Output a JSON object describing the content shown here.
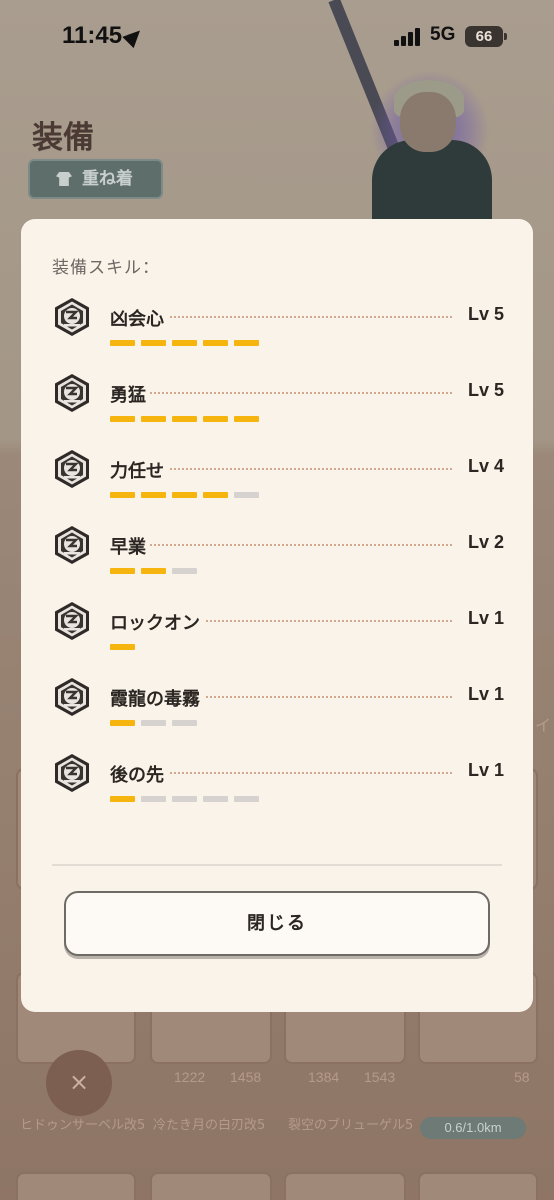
{
  "status_bar": {
    "time": "11:45",
    "network": "5G",
    "battery": "66"
  },
  "background": {
    "title": "装備",
    "stack_button": "重ね着",
    "cards": [
      {
        "nums": [
          "",
          ""
        ],
        "label": "ヒドゥンサーベル改5"
      },
      {
        "nums": [
          "1222",
          "1458"
        ],
        "label": "冷たき月の白刃改5"
      },
      {
        "nums": [
          "1384",
          "1543"
        ],
        "label": "裂空のブリューゲル5"
      },
      {
        "nums": [
          "",
          "58"
        ],
        "label": ""
      }
    ],
    "distance_pill": "0.6/1.0km",
    "close_x": "×"
  },
  "modal": {
    "title": "装備スキル：",
    "skills": [
      {
        "name": "凶会心",
        "level": "Lv 5",
        "filled": 5,
        "max": 5
      },
      {
        "name": "勇猛",
        "level": "Lv 5",
        "filled": 5,
        "max": 5
      },
      {
        "name": "力任せ",
        "level": "Lv 4",
        "filled": 4,
        "max": 5
      },
      {
        "name": "早業",
        "level": "Lv 2",
        "filled": 2,
        "max": 3
      },
      {
        "name": "ロックオン",
        "level": "Lv 1",
        "filled": 1,
        "max": 1
      },
      {
        "name": "霞龍の毒霧",
        "level": "Lv 1",
        "filled": 1,
        "max": 3
      },
      {
        "name": "後の先",
        "level": "Lv 1",
        "filled": 1,
        "max": 5
      }
    ],
    "close_label": "閉じる"
  },
  "colors": {
    "accent": "#f6b40f",
    "bar_off": "#d6d2cf",
    "panel": "#faf3ea"
  }
}
